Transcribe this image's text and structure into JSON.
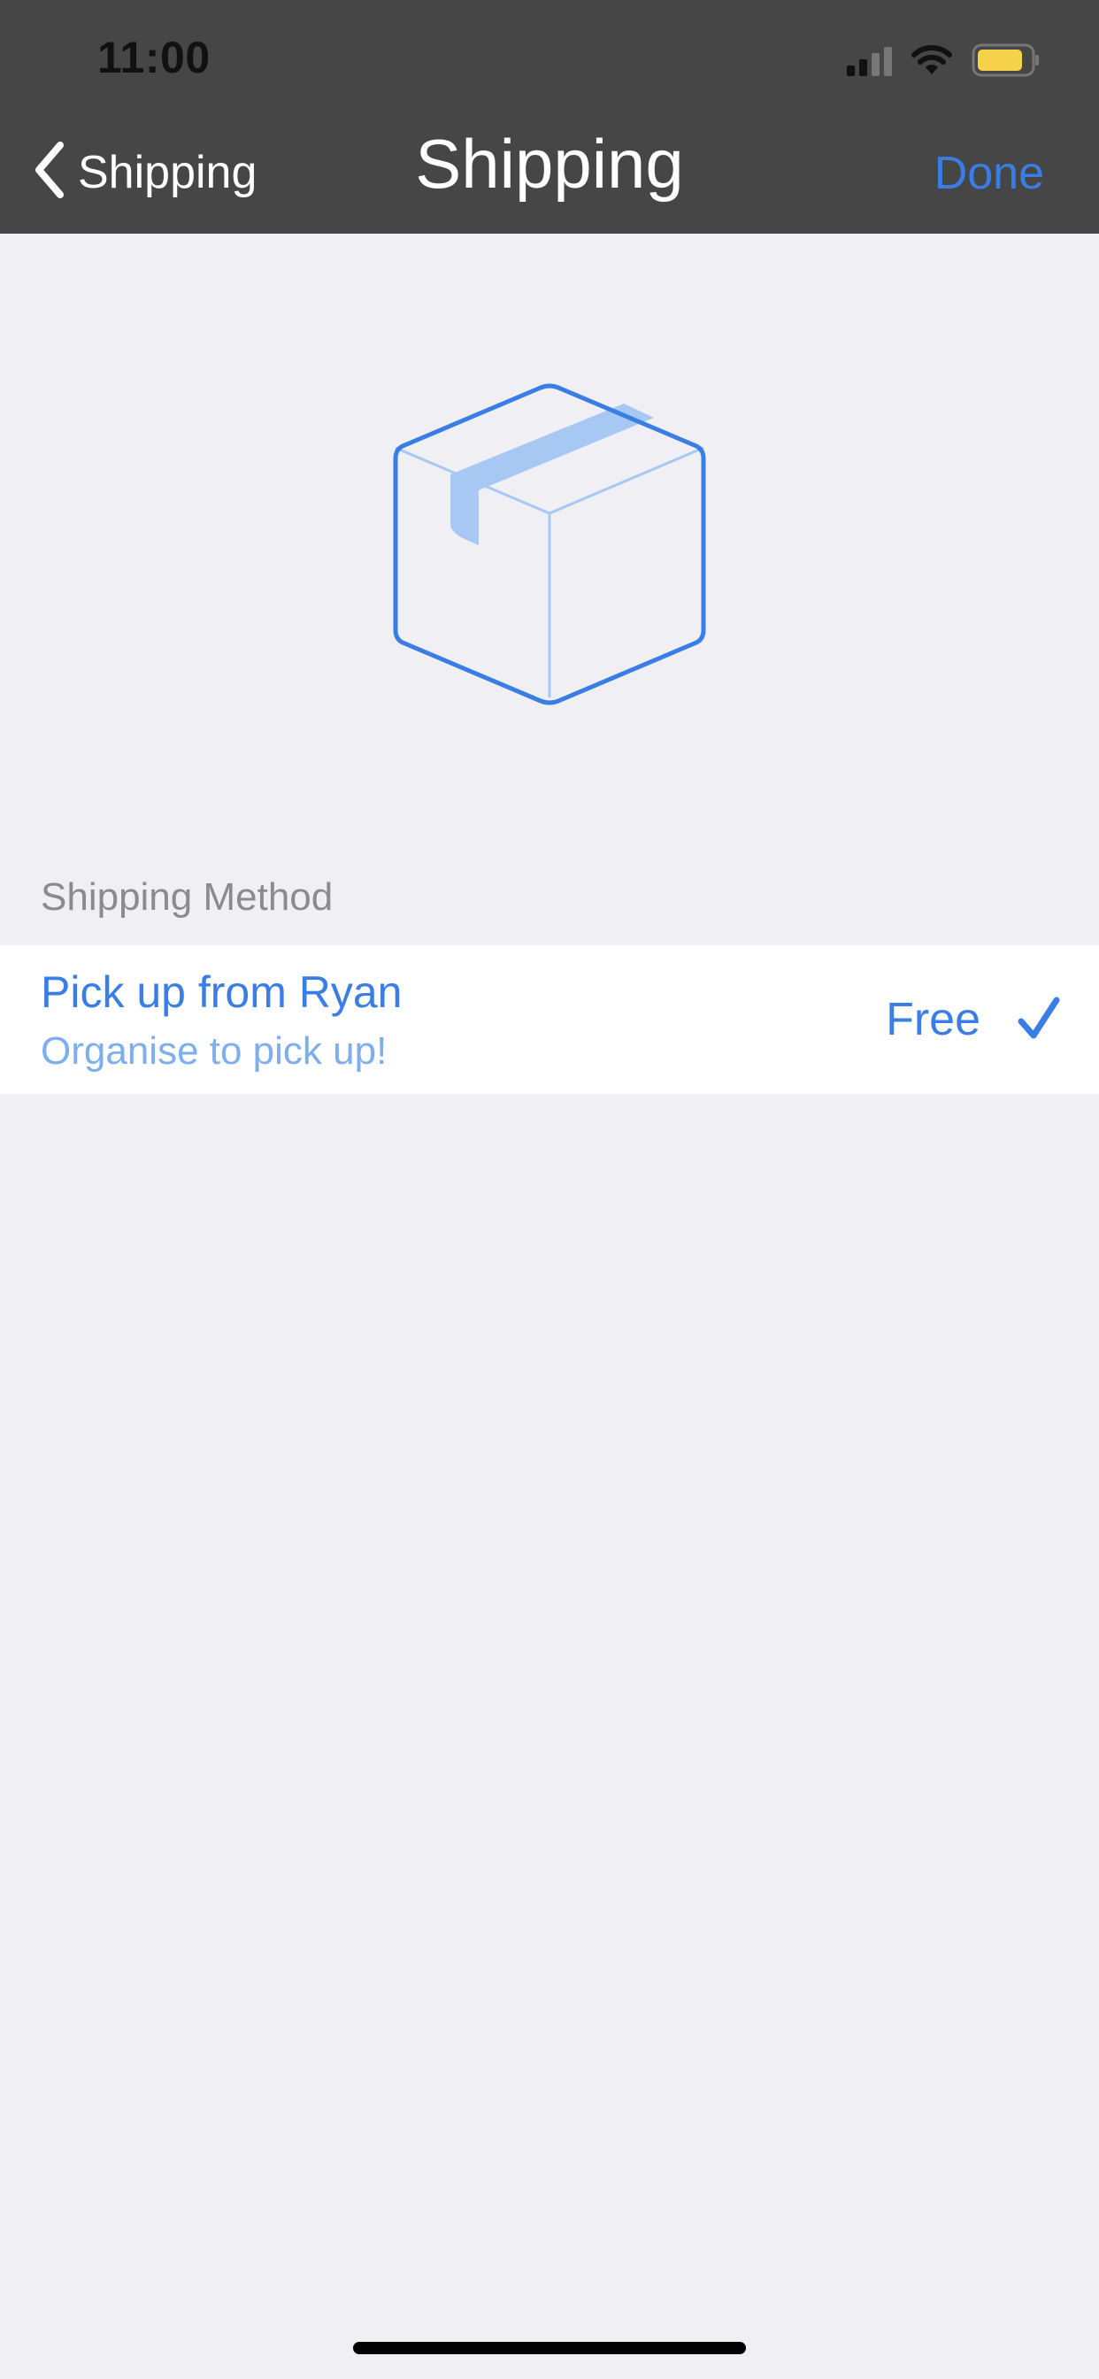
{
  "status_bar": {
    "time": "11:00",
    "signal_icon": "cellular-signal-icon",
    "wifi_icon": "wifi-icon",
    "battery_icon": "battery-icon",
    "battery_color": "#f5d24a"
  },
  "nav": {
    "back_label": "Shipping",
    "back_icon": "chevron-left-icon",
    "title": "Shipping",
    "done_label": "Done"
  },
  "hero": {
    "icon": "package-box-icon"
  },
  "shipping_method": {
    "section_label": "Shipping Method",
    "options": [
      {
        "title": "Pick up from Ryan",
        "subtitle": "Organise to pick up!",
        "price": "Free",
        "selected": true
      }
    ]
  },
  "colors": {
    "accent": "#3a7de4",
    "accent_light": "#7eaeee",
    "nav_background": "#464646",
    "page_background": "#f0f0f4"
  }
}
